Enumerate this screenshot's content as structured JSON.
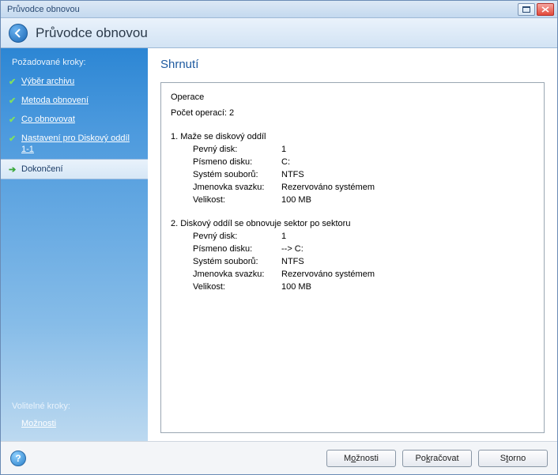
{
  "window": {
    "title": "Průvodce obnovou"
  },
  "header": {
    "title": "Průvodce obnovou"
  },
  "sidebar": {
    "required_heading": "Požadované kroky:",
    "steps": [
      {
        "label": "Výběr archivu",
        "done": true
      },
      {
        "label": "Metoda obnovení",
        "done": true
      },
      {
        "label": "Co obnovovat",
        "done": true
      },
      {
        "label": "Nastavení pro Diskový oddíl 1-1",
        "done": true
      }
    ],
    "active_step": {
      "label": "Dokončení"
    },
    "optional_heading": "Volitelné kroky:",
    "optional_steps": [
      {
        "label": "Možnosti"
      }
    ]
  },
  "main": {
    "title": "Shrnutí",
    "summary": {
      "section_title": "Operace",
      "count_label": "Počet operací: 2",
      "operations": [
        {
          "heading": "1. Maže se diskový oddíl",
          "rows": [
            {
              "k": "Pevný disk:",
              "v": "1"
            },
            {
              "k": "Písmeno disku:",
              "v": "C:"
            },
            {
              "k": "Systém souborů:",
              "v": "NTFS"
            },
            {
              "k": "Jmenovka svazku:",
              "v": "Rezervováno systémem"
            },
            {
              "k": "Velikost:",
              "v": "100 MB"
            }
          ]
        },
        {
          "heading": "2. Diskový oddíl se obnovuje sektor po sektoru",
          "rows": [
            {
              "k": "Pevný disk:",
              "v": "1"
            },
            {
              "k": "Písmeno disku:",
              "v": "--> C:"
            },
            {
              "k": "Systém souborů:",
              "v": "NTFS"
            },
            {
              "k": "Jmenovka svazku:",
              "v": "Rezervováno systémem"
            },
            {
              "k": "Velikost:",
              "v": "100 MB"
            }
          ]
        }
      ]
    }
  },
  "footer": {
    "options_prefix": "M",
    "options_ul": "o",
    "options_suffix": "žnosti",
    "continue_prefix": "Po",
    "continue_ul": "k",
    "continue_suffix": "račovat",
    "cancel_prefix": "S",
    "cancel_ul": "t",
    "cancel_suffix": "orno"
  }
}
